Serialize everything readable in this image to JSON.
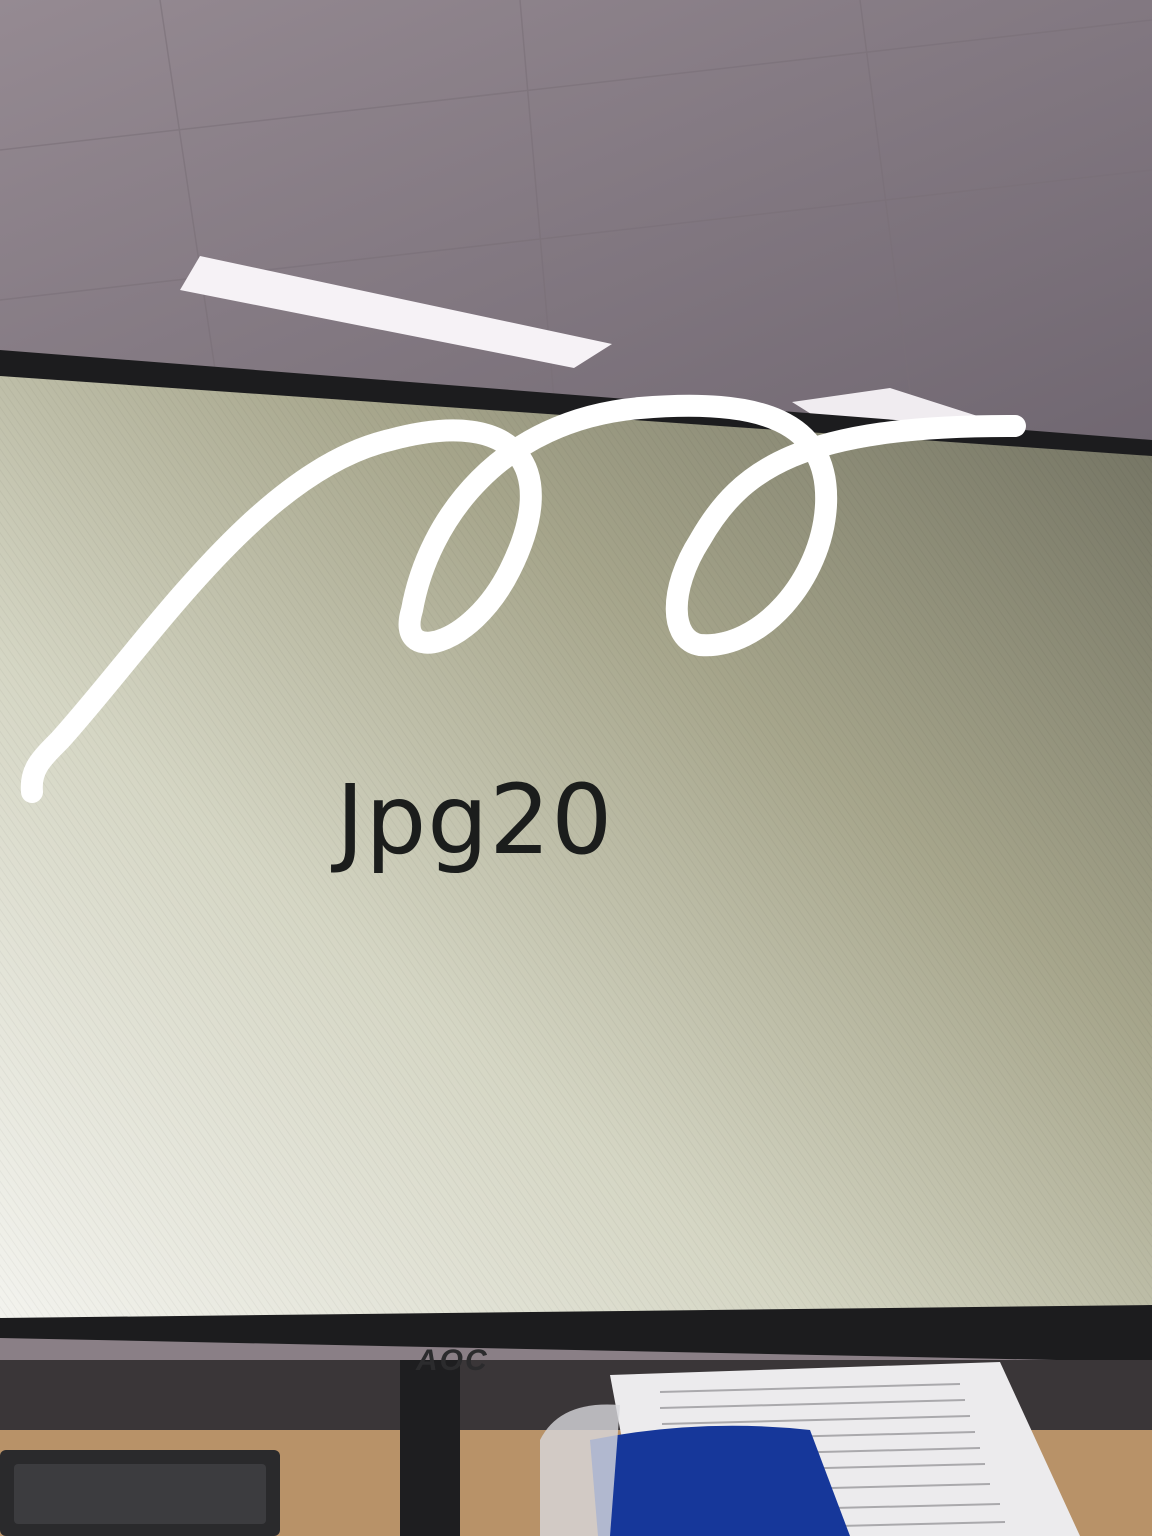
{
  "scene": {
    "description_free": true,
    "screen_text": "Jpg20",
    "monitor_brand": "AOC",
    "colors": {
      "ceiling": "#8c8189",
      "ceiling_light": "#f6f2f6",
      "screen_top": "#7b7b68",
      "screen_bottom": "#f1f1ec",
      "bezel": "#1c1c1e",
      "scribble": "#ffffff",
      "cushion": "#16379a",
      "paper": "#ecebed",
      "desk": "#b89268"
    },
    "icons": [
      "scribble-stroke"
    ]
  }
}
